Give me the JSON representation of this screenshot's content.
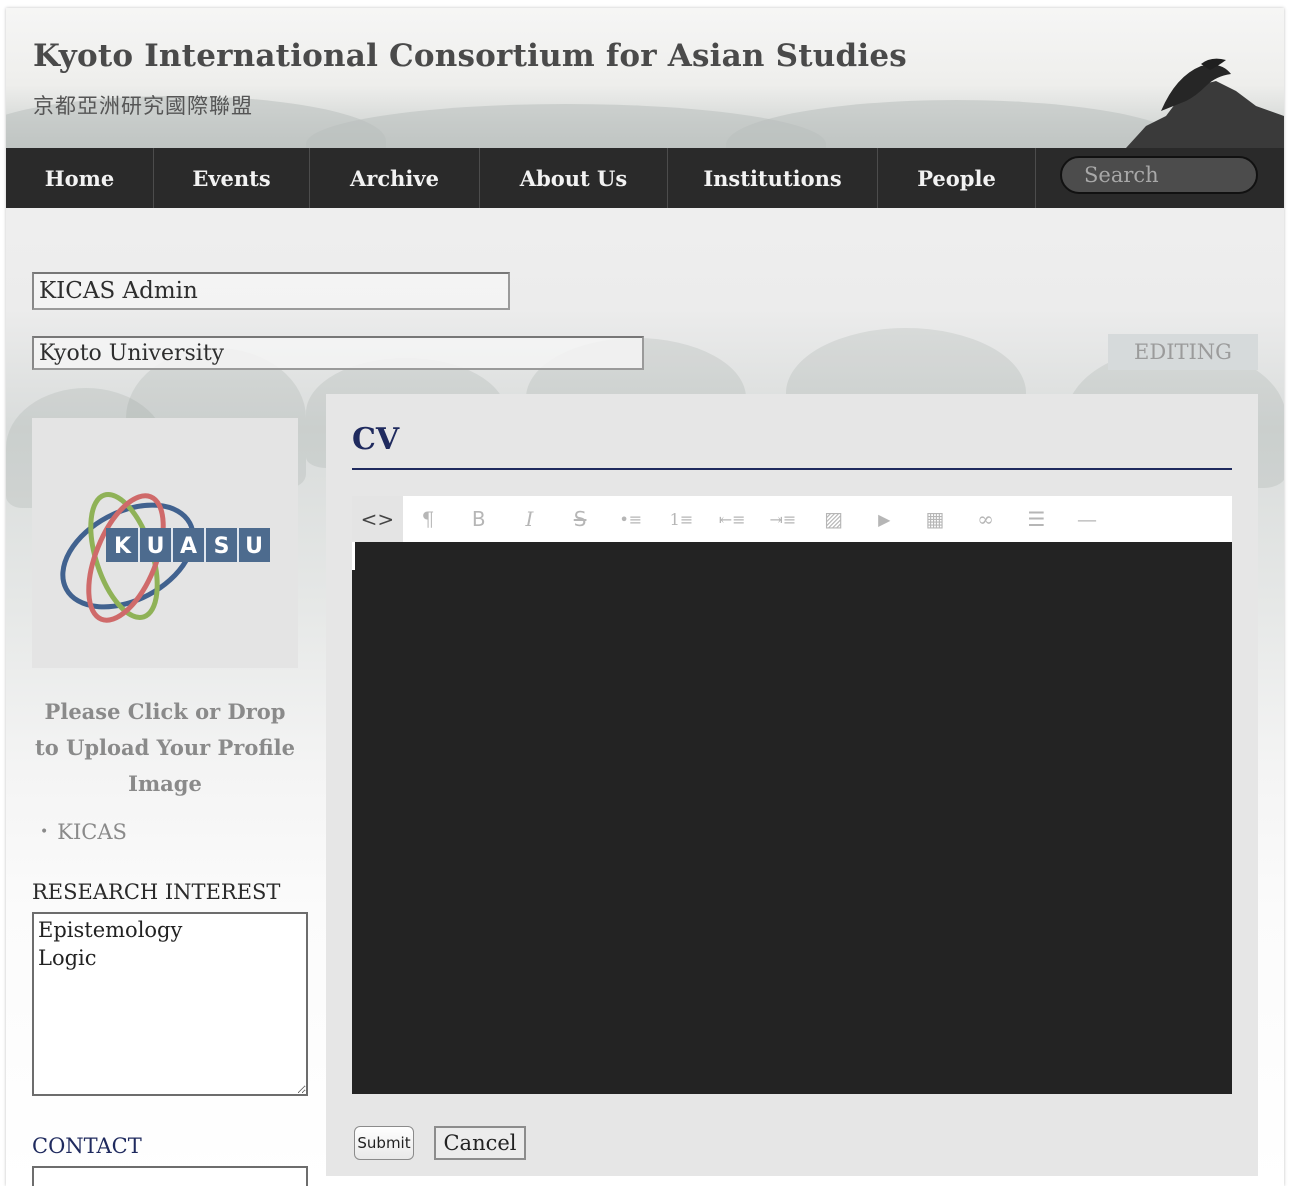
{
  "site": {
    "title": "Kyoto International Consortium for Asian Studies",
    "subtitle": "京都亞洲研究國際聯盟"
  },
  "nav": {
    "items": [
      {
        "label": "Home"
      },
      {
        "label": "Events"
      },
      {
        "label": "Archive"
      },
      {
        "label": "About Us"
      },
      {
        "label": "Institutions"
      },
      {
        "label": "People"
      }
    ],
    "search_placeholder": "Search"
  },
  "profile": {
    "name": "KICAS Admin",
    "institution": "Kyoto University",
    "editing_badge": "EDITING",
    "logo_letters": [
      "K",
      "U",
      "A",
      "S",
      "U"
    ],
    "upload_hint": "Please Click or Drop to Upload Your Profile Image",
    "affiliations": [
      "KICAS"
    ],
    "research_label": "RESEARCH INTEREST",
    "research_text": "Epistemology\nLogic",
    "contact_label": "CONTACT"
  },
  "cv": {
    "title": "CV",
    "toolbar": [
      {
        "icon": "code-view-icon",
        "glyph": "<>",
        "active": true
      },
      {
        "icon": "paragraph-icon",
        "glyph": "¶",
        "active": false
      },
      {
        "icon": "bold-icon",
        "glyph": "B",
        "active": false
      },
      {
        "icon": "italic-icon",
        "glyph": "I",
        "active": false
      },
      {
        "icon": "strikethrough-icon",
        "glyph": "S",
        "active": false
      },
      {
        "icon": "bulleted-list-icon",
        "glyph": "•≡",
        "active": false
      },
      {
        "icon": "numbered-list-icon",
        "glyph": "1≡",
        "active": false
      },
      {
        "icon": "outdent-icon",
        "glyph": "⇤≡",
        "active": false
      },
      {
        "icon": "indent-icon",
        "glyph": "⇥≡",
        "active": false
      },
      {
        "icon": "image-icon",
        "glyph": "▨",
        "active": false
      },
      {
        "icon": "video-icon",
        "glyph": "▶",
        "active": false
      },
      {
        "icon": "table-icon",
        "glyph": "▦",
        "active": false
      },
      {
        "icon": "link-icon",
        "glyph": "∞",
        "active": false
      },
      {
        "icon": "align-icon",
        "glyph": "☰",
        "active": false
      },
      {
        "icon": "horizontal-rule-icon",
        "glyph": "—",
        "active": false
      }
    ]
  },
  "actions": {
    "submit_label": "Submit",
    "cancel_label": "Cancel"
  },
  "colors": {
    "nav_background": "#2a2a2a",
    "cv_heading": "#1f2a5e",
    "editor_background": "#232323"
  }
}
